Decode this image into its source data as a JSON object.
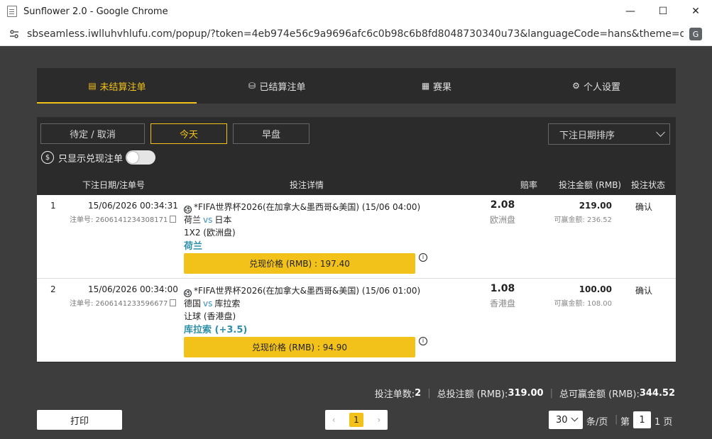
{
  "window": {
    "title": "Sunflower 2.0 - Google Chrome",
    "url": "sbseamless.iwlluhvhlufu.com/popup/?token=4eb974e56c9a9696afc6c0b98c6b8fd8048730340u73&languageCode=hans&theme=defa...",
    "minimize": "—",
    "maximize": "☐",
    "close": "✕"
  },
  "tabs": [
    {
      "label": "未结算注单",
      "icon": "📋"
    },
    {
      "label": "已结算注单",
      "icon": "📑"
    },
    {
      "label": "赛果",
      "icon": "📰"
    },
    {
      "label": "个人设置",
      "icon": "⚙"
    }
  ],
  "filters": {
    "pending": "待定 / 取消",
    "today": "今天",
    "early": "早盘",
    "sort": "下注日期排序",
    "cashout_only": "只显示兑现注单",
    "money_icon": "$"
  },
  "table_headers": {
    "date": "下注日期/注单号",
    "details": "投注详情",
    "odds": "赔率",
    "stake": "投注金额 (RMB)",
    "status": "投注状态"
  },
  "bets": [
    {
      "num": "1",
      "date": "15/06/2026 00:34:31",
      "ticket": "注单号: 2606141234308171",
      "match": "*FIFA世界杯2026(在加拿大&墨西哥&美国) (15/06 04:00)",
      "home": "荷兰",
      "vs": "vs",
      "away": "日本",
      "market": "1X2 (欧洲盘)",
      "pick": "荷兰",
      "cashout": "兑现价格 (RMB) : 197.40",
      "odds": "2.08",
      "odds_type": "欧洲盘",
      "stake": "219.00",
      "win": "可赢金额: 236.52",
      "status": "确认"
    },
    {
      "num": "2",
      "date": "15/06/2026 00:34:00",
      "ticket": "注单号: 2606141233596677",
      "match": "*FIFA世界杯2026(在加拿大&墨西哥&美国) (15/06 01:00)",
      "home": "德国",
      "vs": "vs",
      "away": "库拉索",
      "market": "让球 (香港盘)",
      "pick": "库拉索 (+3.5)",
      "cashout": "兑现价格 (RMB) : 94.90",
      "odds": "1.08",
      "odds_type": "香港盘",
      "stake": "100.00",
      "win": "可赢金额: 108.00",
      "status": "确认"
    }
  ],
  "totals": {
    "count_label": "投注单数:",
    "count": "2",
    "stake_label": "总投注额 (RMB):",
    "stake": "319.00",
    "win_label": "总可赢金额 (RMB):",
    "win": "344.52"
  },
  "footer": {
    "print": "打印",
    "prev": "‹",
    "current_page": "1",
    "next": "›",
    "page_size": "30",
    "per_page": "条/页",
    "goto": "第",
    "goto_value": "1",
    "total_pages": "1 页"
  },
  "colors": {
    "accent": "#f3c21b",
    "panel": "#2b2b2b",
    "pick": "#2e8fa7"
  }
}
